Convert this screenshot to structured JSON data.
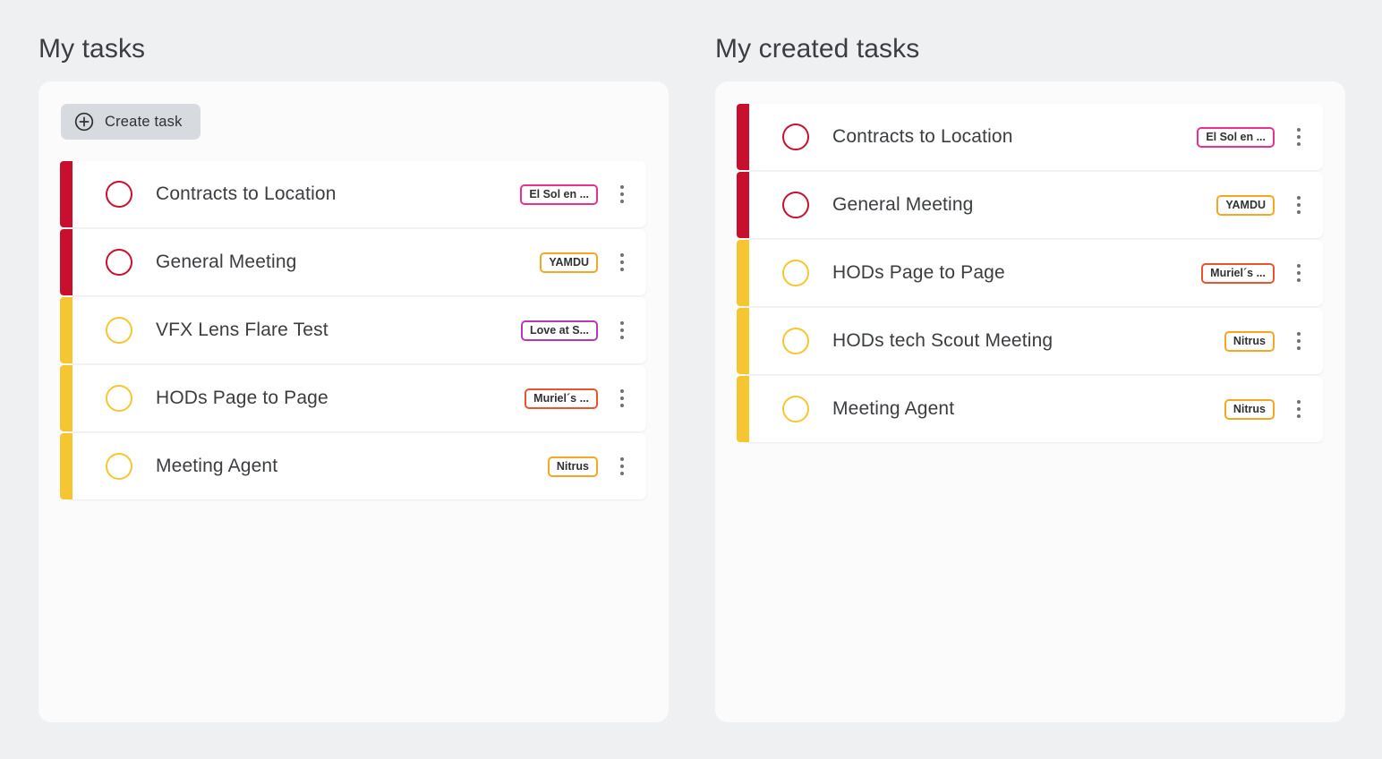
{
  "theme": {
    "page_background": "#eff0f2",
    "card_background": "#fbfbfb",
    "row_background": "#ffffff",
    "text_color": "#3b3d40",
    "accent_red": "#c8102e",
    "accent_yellow": "#f6c632",
    "button_background": "#d7dade"
  },
  "columns": [
    {
      "title": "My tasks",
      "create_button": {
        "label": "Create task",
        "icon": "plus-circle-icon"
      },
      "tasks": [
        {
          "title": "Contracts to Location",
          "accent": "red",
          "status_icon": "circle-outline-icon",
          "badge": {
            "label": "El Sol en ...",
            "color": "#e8318f"
          },
          "menu_icon": "more-vertical-icon"
        },
        {
          "title": "General Meeting",
          "accent": "red",
          "status_icon": "circle-outline-icon",
          "badge": {
            "label": "YAMDU",
            "color": "#f5a623"
          },
          "menu_icon": "more-vertical-icon"
        },
        {
          "title": "VFX Lens Flare Test",
          "accent": "yellow",
          "status_icon": "circle-outline-icon",
          "badge": {
            "label": "Love at S...",
            "color": "#b33ab3"
          },
          "menu_icon": "more-vertical-icon"
        },
        {
          "title": "HODs Page to Page",
          "accent": "yellow",
          "status_icon": "circle-outline-icon",
          "badge": {
            "label": "Muriel´s ...",
            "color": "#e8542f"
          },
          "menu_icon": "more-vertical-icon"
        },
        {
          "title": "Meeting Agent",
          "accent": "yellow",
          "status_icon": "circle-outline-icon",
          "badge": {
            "label": "Nitrus",
            "color": "#f5a623"
          },
          "menu_icon": "more-vertical-icon"
        }
      ]
    },
    {
      "title": "My created tasks",
      "tasks": [
        {
          "title": "Contracts to Location",
          "accent": "red",
          "status_icon": "circle-outline-icon",
          "badge": {
            "label": "El Sol en ...",
            "color": "#e8318f"
          },
          "menu_icon": "more-vertical-icon"
        },
        {
          "title": "General Meeting",
          "accent": "red",
          "status_icon": "circle-outline-icon",
          "badge": {
            "label": "YAMDU",
            "color": "#f5a623"
          },
          "menu_icon": "more-vertical-icon"
        },
        {
          "title": "HODs Page to Page",
          "accent": "yellow",
          "status_icon": "circle-outline-icon",
          "badge": {
            "label": "Muriel´s ...",
            "color": "#e8542f"
          },
          "menu_icon": "more-vertical-icon"
        },
        {
          "title": "HODs tech Scout Meeting",
          "accent": "yellow",
          "status_icon": "circle-outline-icon",
          "badge": {
            "label": "Nitrus",
            "color": "#f5a623"
          },
          "menu_icon": "more-vertical-icon"
        },
        {
          "title": "Meeting Agent",
          "accent": "yellow",
          "status_icon": "circle-outline-icon",
          "badge": {
            "label": "Nitrus",
            "color": "#f5a623"
          },
          "menu_icon": "more-vertical-icon"
        }
      ]
    }
  ]
}
